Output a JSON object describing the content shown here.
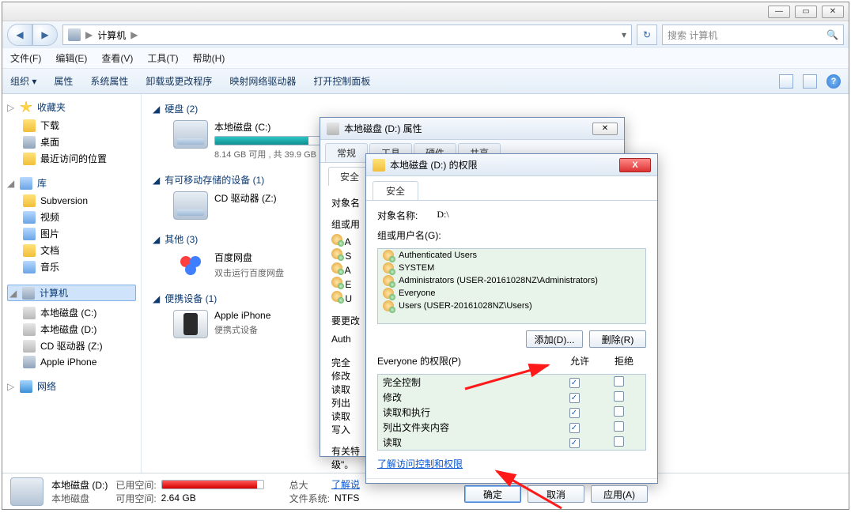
{
  "window": {
    "min": "—",
    "max": "▭",
    "close": "✕"
  },
  "nav": {
    "back": "◀",
    "forward": "▶"
  },
  "breadcrumb": {
    "icon_label": "computer-icon",
    "root": "计算机",
    "sep": "▶",
    "dd": "▾",
    "refresh": "↻"
  },
  "search": {
    "placeholder": "搜索 计算机",
    "icon": "🔍"
  },
  "menu": {
    "file": "文件(F)",
    "edit": "编辑(E)",
    "view": "查看(V)",
    "tools": "工具(T)",
    "help": "帮助(H)"
  },
  "toolbar": {
    "org": "组织 ▾",
    "prop": "属性",
    "sysprop": "系统属性",
    "uninstall": "卸载或更改程序",
    "mapdrive": "映射网络驱动器",
    "ctrlpanel": "打开控制面板"
  },
  "sidebar": {
    "fav": {
      "label": "收藏夹",
      "items": [
        "下载",
        "桌面",
        "最近访问的位置"
      ]
    },
    "lib": {
      "label": "库",
      "items": [
        "Subversion",
        "视频",
        "图片",
        "文档",
        "音乐"
      ]
    },
    "comp": {
      "label": "计算机",
      "items": [
        "本地磁盘 (C:)",
        "本地磁盘 (D:)",
        "CD 驱动器 (Z:)",
        "Apple iPhone"
      ]
    },
    "net": {
      "label": "网络"
    }
  },
  "content": {
    "hdd": {
      "title": "硬盘 (2)",
      "drive0": {
        "name": "本地磁盘 (C:)",
        "sub": "8.14 GB 可用 , 共 39.9 GB",
        "pct": 80
      }
    },
    "removable": {
      "title": "有可移动存储的设备 (1)",
      "drive0": {
        "name": "CD 驱动器 (Z:)"
      }
    },
    "other": {
      "title": "其他 (3)",
      "item0": {
        "name": "百度网盘",
        "sub": "双击运行百度网盘"
      }
    },
    "portable": {
      "title": "便携设备 (1)",
      "item0": {
        "name": "Apple iPhone",
        "sub": "便携式设备"
      }
    }
  },
  "status": {
    "sel_name": "本地磁盘 (D:)",
    "sel_type": "本地磁盘",
    "used_k": "已用空间:",
    "used_pct": 94,
    "total_k": "总大",
    "free_k": "可用空间:",
    "free_v": "2.64 GB",
    "fs_k": "文件系统:",
    "fs_v": "NTFS"
  },
  "prop_dlg": {
    "title": "本地磁盘 (D:) 属性",
    "close": "✕",
    "tabs": {
      "general": "常规",
      "tools": "工具",
      "hardware": "硬件",
      "share": "共享",
      "security": "安全"
    },
    "obj_k": "对象名",
    "grp_k": "组或用",
    "frag": [
      "A",
      "S",
      "A",
      "E",
      "U"
    ],
    "change_k": "要更改",
    "note1": "Auth",
    "note2": "完全",
    "note3": "修改",
    "note4": "读取",
    "note5": "列出",
    "note6": "读取",
    "note7": "写入",
    "note_foot": "有关特",
    "note_foot2": "级\"。",
    "link": "了解说"
  },
  "perm_dlg": {
    "title": "本地磁盘 (D:) 的权限",
    "close": "X",
    "tab": "安全",
    "obj_k": "对象名称:",
    "obj_v": "D:\\",
    "grp_k": "组或用户名(G):",
    "users": [
      "Authenticated Users",
      "SYSTEM",
      "Administrators (USER-20161028NZ\\Administrators)",
      "Everyone",
      "Users (USER-20161028NZ\\Users)"
    ],
    "add": "添加(D)...",
    "remove": "删除(R)",
    "perm_label": "Everyone 的权限(P)",
    "allow": "允许",
    "deny": "拒绝",
    "rows": [
      {
        "label": "完全控制",
        "allow": true,
        "deny": false
      },
      {
        "label": "修改",
        "allow": true,
        "deny": false
      },
      {
        "label": "读取和执行",
        "allow": true,
        "deny": false
      },
      {
        "label": "列出文件夹内容",
        "allow": true,
        "deny": false
      },
      {
        "label": "读取",
        "allow": true,
        "deny": false
      }
    ],
    "link": "了解访问控制和权限",
    "ok": "确定",
    "cancel": "取消",
    "apply": "应用(A)"
  }
}
